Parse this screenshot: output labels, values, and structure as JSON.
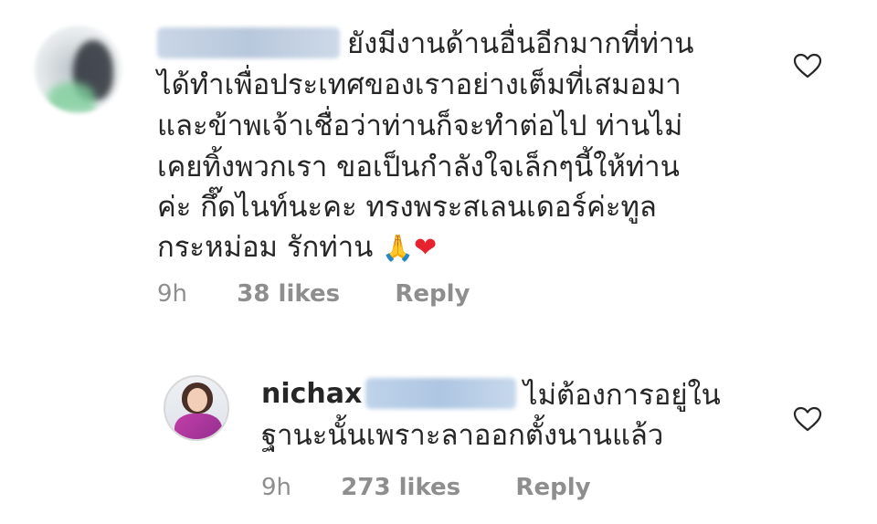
{
  "comments": [
    {
      "username_redacted": true,
      "lines": [
        "ยังมีงานด้านอื่นอีกมากที่ท่าน",
        "ได้ทำเพื่อประเทศของเราอย่างเต็มที่เสมอมา",
        "และข้าพเจ้าเชื่อว่าท่านก็จะทำต่อไป ท่านไม่",
        "เคยทิ้งพวกเรา ขอเป็นกำลังใจเล็กๆนี้ให้ท่าน",
        "ค่ะ กึ๊ดไนท์นะคะ ทรงพระสเลนเดอร์ค่ะทูล",
        "กระหม่อม รักท่าน"
      ],
      "emojis": [
        "🙏",
        "❤"
      ],
      "time": "9h",
      "likes": "38 likes",
      "reply": "Reply"
    },
    {
      "username": "nichax",
      "mention_redacted": true,
      "lines": [
        "ไม่ต้องการอยู่ใน",
        "ฐานะนั้นเพราะลาออกตั้งนานแล้ว"
      ],
      "time": "9h",
      "likes": "273 likes",
      "reply": "Reply"
    }
  ],
  "icons": {
    "like": "heart-outline-icon"
  },
  "colors": {
    "text": "#262626",
    "meta": "#8e8e8e",
    "heart_emoji": "#e8212e"
  }
}
